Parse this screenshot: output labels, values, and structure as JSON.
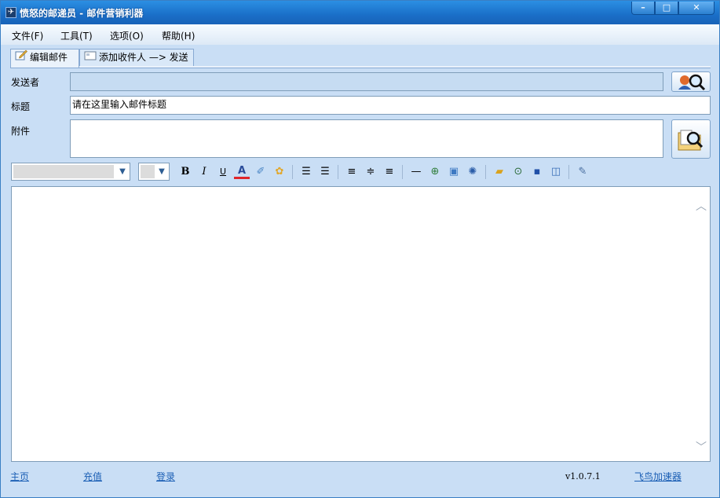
{
  "window": {
    "title": "愤怒的邮递员 - 邮件营销利器",
    "controls": {
      "minimize": "–",
      "maximize": "□",
      "close": "✕"
    }
  },
  "menu": [
    "文件(F)",
    "工具(T)",
    "选项(O)",
    "帮助(H)"
  ],
  "tabs": [
    {
      "label": "编辑邮件",
      "icon": "edit-icon",
      "active": true
    },
    {
      "label": "添加收件人 —> 发送",
      "icon": "envelope-icon",
      "active": false
    }
  ],
  "form": {
    "sender_label": "发送者",
    "sender_value": "",
    "subject_label": "标题",
    "subject_value": "请在这里输入邮件标题",
    "attachment_label": "附件",
    "attachment_value": ""
  },
  "toolbar": {
    "font_family": "",
    "font_size": "",
    "bold": "B",
    "italic": "I",
    "underline": "U",
    "font_color": "A",
    "icons": [
      "bold-icon",
      "italic-icon",
      "underline-icon",
      "font-color-icon",
      "highlight-icon",
      "palette-icon",
      "indent-decrease-icon",
      "indent-increase-icon",
      "align-left-icon",
      "align-center-icon",
      "align-right-icon",
      "horizontal-rule-icon",
      "link-icon",
      "image-icon",
      "flash-icon",
      "open-folder-icon",
      "preview-icon",
      "save-icon",
      "save-as-icon",
      "edit-source-icon"
    ]
  },
  "editor": {
    "content": ""
  },
  "status_bar": {
    "home": "主页",
    "recharge": "充值",
    "login": "登录",
    "version": "v1.0.7.1",
    "accelerator": "飞鸟加速器"
  },
  "colors": {
    "titlebar": "#1a6fc8",
    "window_bg": "#c9def5",
    "link": "#1b5fb5"
  }
}
